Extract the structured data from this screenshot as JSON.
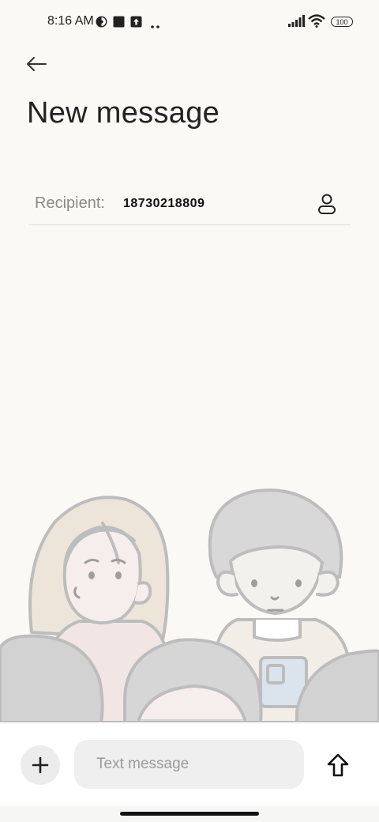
{
  "status_bar": {
    "time": "8:16 AM",
    "battery": "100",
    "icons": [
      "app-notification-icon",
      "square-notification-icon",
      "upload-notification-icon",
      "more-dots-icon",
      "signal-icon",
      "wifi-icon",
      "battery-icon"
    ]
  },
  "header": {
    "back_icon": "arrow-left-icon",
    "title": "New message"
  },
  "recipient": {
    "label": "Recipient:",
    "value": "18730218809",
    "contact_icon": "person-icon"
  },
  "composer": {
    "add_icon": "plus-icon",
    "placeholder": "Text message",
    "send_icon": "send-arrow-icon"
  },
  "colors": {
    "background": "#faf9f6",
    "composer_bg": "#ffffff",
    "input_bg": "#efefef",
    "illustration_line": "#b9b9b9"
  }
}
